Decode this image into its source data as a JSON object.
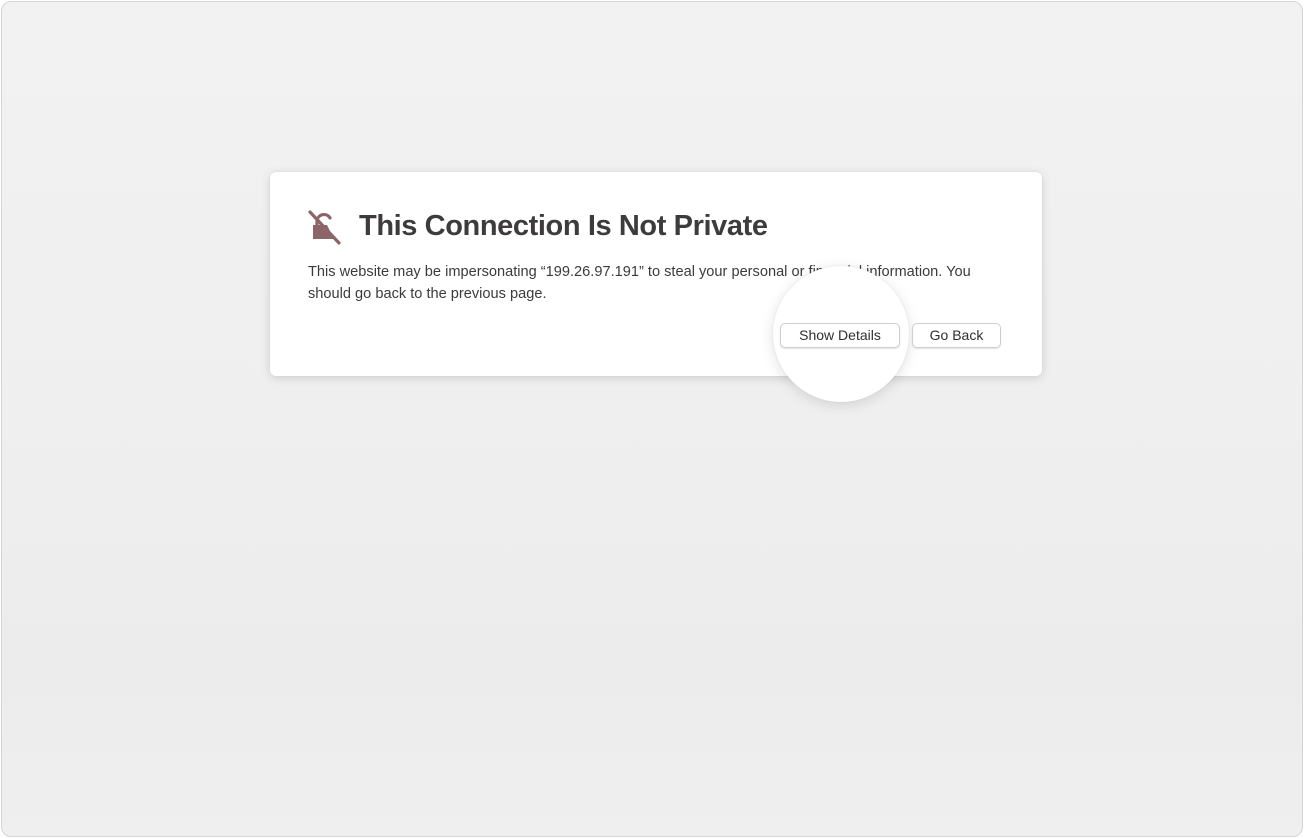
{
  "dialog": {
    "title": "This Connection Is Not Private",
    "message": "This website may be impersonating “199.26.97.191” to steal your personal or financial information. You should go back to the previous page.",
    "icon": "lock-slash-icon",
    "icon_color": "#8c6569"
  },
  "buttons": {
    "show_details_label": "Show Details",
    "go_back_label": "Go Back"
  },
  "colors": {
    "background": "#f0f0f0",
    "card": "#ffffff",
    "title_text": "#3d3b3c"
  }
}
